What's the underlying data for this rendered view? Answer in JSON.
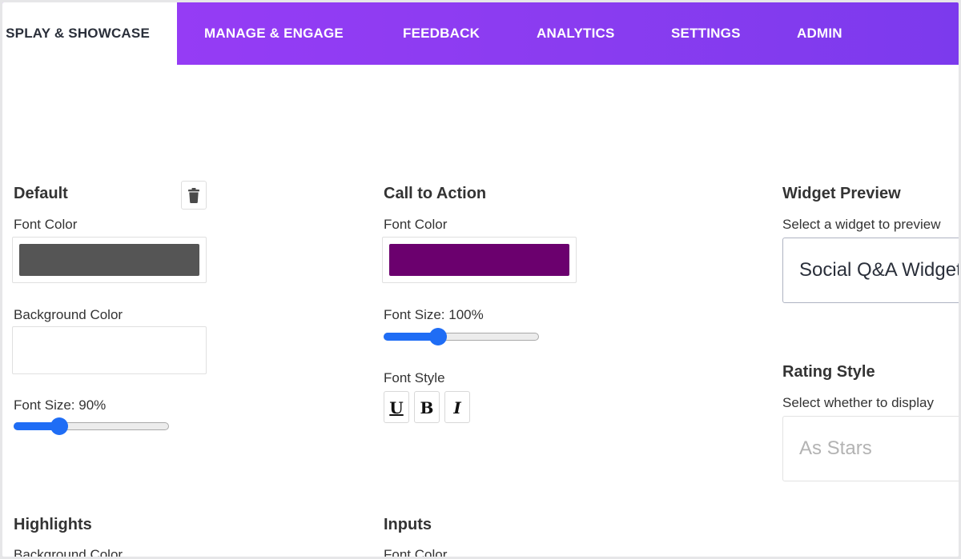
{
  "nav": {
    "tabs": [
      {
        "label": "SPLAY & SHOWCASE",
        "active": true
      },
      {
        "label": "MANAGE & ENGAGE"
      },
      {
        "label": "FEEDBACK"
      },
      {
        "label": "ANALYTICS"
      },
      {
        "label": "SETTINGS"
      },
      {
        "label": "ADMIN"
      }
    ]
  },
  "default_section": {
    "title": "Default",
    "delete_icon": "trash-icon",
    "font_color_label": "Font Color",
    "font_color_value": "#555555",
    "background_color_label": "Background Color",
    "background_color_value": "#ffffff",
    "font_size_label": "Font Size: 90%",
    "font_size_percent": 90
  },
  "call_to_action": {
    "title": "Call to Action",
    "font_color_label": "Font Color",
    "font_color_value": "#6b006e",
    "font_size_label": "Font Size: 100%",
    "font_size_percent": 100,
    "font_style_label": "Font Style",
    "style_buttons": [
      "U",
      "B",
      "I"
    ]
  },
  "widget_preview": {
    "title": "Widget Preview",
    "description": "Select a widget to preview",
    "selected": "Social Q&A Widget"
  },
  "rating_style": {
    "title": "Rating Style",
    "description": "Select whether to display",
    "placeholder": "As Stars"
  },
  "highlights": {
    "title": "Highlights",
    "background_color_label": "Background Color"
  },
  "inputs": {
    "title": "Inputs",
    "font_color_label": "Font Color"
  },
  "colors": {
    "accent": "#8a3cf0",
    "slider": "#1f6df5"
  }
}
